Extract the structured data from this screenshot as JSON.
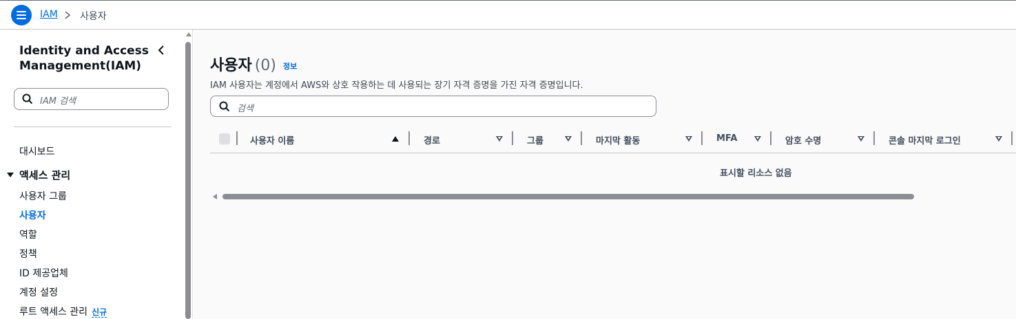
{
  "breadcrumb": {
    "root": "IAM",
    "current": "사용자"
  },
  "sidebar": {
    "title": "Identity and Access Management(IAM)",
    "search_placeholder": "IAM 검색",
    "dashboard": "대시보드",
    "section_label": "액세스 관리",
    "items": [
      {
        "label": "사용자 그룹"
      },
      {
        "label": "사용자"
      },
      {
        "label": "역할"
      },
      {
        "label": "정책"
      },
      {
        "label": "ID 제공업체"
      },
      {
        "label": "계정 설정"
      },
      {
        "label": "루트 액세스 관리",
        "badge": "신규"
      }
    ]
  },
  "main": {
    "title": "사용자",
    "count": "(0)",
    "info": "정보",
    "description": "IAM 사용자는 계정에서 AWS와 상호 작용하는 데 사용되는 장기 자격 증명을 가진 자격 증명입니다.",
    "search_placeholder": "검색",
    "columns": [
      "사용자 이름",
      "경로",
      "그룹",
      "마지막 활동",
      "MFA",
      "암호 수명",
      "콘솔 마지막 로그인"
    ],
    "empty_text": "표시할 리소스 없음"
  },
  "colors": {
    "accent": "#006ce0",
    "text": "#0f141a",
    "border": "#8c8c94"
  }
}
